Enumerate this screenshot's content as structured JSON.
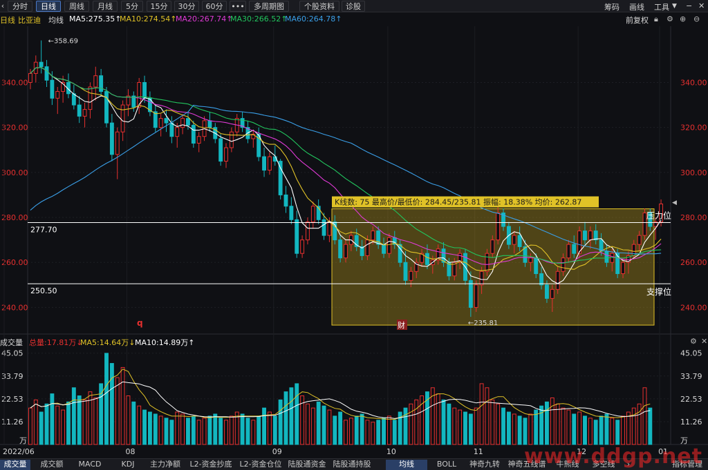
{
  "toolbar": {
    "left_icon": "chevron-left-icon",
    "tabs": [
      {
        "label": "分时",
        "active": false
      },
      {
        "label": "日线",
        "active": true
      },
      {
        "label": "周线",
        "active": false
      },
      {
        "label": "月线",
        "active": false
      },
      {
        "label": "5分",
        "active": false
      },
      {
        "label": "15分",
        "active": false
      },
      {
        "label": "30分",
        "active": false
      },
      {
        "label": "60分",
        "active": false
      },
      {
        "label": "•••",
        "active": false
      },
      {
        "label": "多周期图",
        "active": false
      },
      {
        "label": "个股资料",
        "active": false
      },
      {
        "label": "诊股",
        "active": false
      }
    ],
    "right": {
      "chips": "筹码",
      "draw": "画线",
      "tools": "工具"
    }
  },
  "ma_bar": {
    "period": "日线",
    "stock_name": "比亚迪",
    "avg_line": "均线",
    "ma5": "MA5:275.35↑",
    "ma10": "MA10:274.54↑",
    "ma20": "MA20:267.74↑",
    "ma30": "MA30:266.52↑",
    "ma60": "MA60:264.78↑",
    "adjust": "前复权"
  },
  "annotations": {
    "high_label": "358.69",
    "low_label": "235.81",
    "info_box": "K线数: 75 最高价/最低价: 284.45/235.81 振幅: 18.38% 均价: 262.87",
    "line_upper_value": "277.70",
    "line_lower_value": "250.50",
    "resistance": "压力位",
    "support": "支撑位",
    "marker_q": "q",
    "marker_cai": "财"
  },
  "vol_bar": {
    "title": "成交量",
    "total": "总量:17.81万↓",
    "ma5": "MA5:14.64万↓",
    "ma10": "MA10:14.89万↑"
  },
  "axis": {
    "price_ticks": [
      "340.00",
      "320.00",
      "300.00",
      "280.00",
      "260.00",
      "240.00"
    ],
    "vol_ticks": [
      "45.05",
      "33.79",
      "22.53",
      "11.26",
      "万"
    ],
    "dates": [
      "2022/06",
      "08",
      "09",
      "10",
      "11",
      "12",
      "01"
    ]
  },
  "bottom_tabs": [
    {
      "label": "成交量",
      "active": true
    },
    {
      "label": "成交额",
      "active": false
    },
    {
      "label": "MACD",
      "active": false
    },
    {
      "label": "KDJ",
      "active": false
    },
    {
      "label": "主力净额",
      "active": false
    },
    {
      "label": "L2-资金抄底",
      "active": false
    },
    {
      "label": "L2-资金仓位",
      "active": false
    },
    {
      "label": "陆股通资金",
      "active": false
    },
    {
      "label": "陆股通持股",
      "active": false
    },
    {
      "label": "均线",
      "active": true
    },
    {
      "label": "BOLL",
      "active": false
    },
    {
      "label": "神奇九转",
      "active": false
    },
    {
      "label": "神奇五线谱",
      "active": false
    },
    {
      "label": "牛熊线",
      "active": false
    },
    {
      "label": "多空线",
      "active": false
    },
    {
      "label": "指标管理",
      "active": false
    }
  ],
  "watermark": "www.ddgp.net",
  "colors": {
    "up": "#e8302f",
    "down": "#13b7c0",
    "ma5": "#ffffff",
    "ma10": "#e0c227",
    "ma20": "#e03ad6",
    "ma30": "#22c55e",
    "ma60": "#3a9fe8"
  },
  "chart_data": {
    "type": "candlestick",
    "ylim": [
      230,
      365
    ],
    "high": 358.69,
    "low": 235.81,
    "levels": [
      277.7,
      250.5
    ],
    "box": {
      "count": 75,
      "high": 284.45,
      "low": 235.81,
      "amplitude": "18.38%",
      "avg": 262.87,
      "range": [
        235.81,
        284.45
      ]
    },
    "ohlc": [
      [
        340,
        346,
        337,
        344
      ],
      [
        344,
        352,
        340,
        349
      ],
      [
        349,
        358.69,
        344,
        347
      ],
      [
        347,
        350,
        338,
        341
      ],
      [
        341,
        345,
        330,
        333
      ],
      [
        333,
        338,
        326,
        336
      ],
      [
        336,
        343,
        331,
        340
      ],
      [
        340,
        344,
        333,
        335
      ],
      [
        335,
        339,
        328,
        330
      ],
      [
        330,
        334,
        322,
        325
      ],
      [
        325,
        331,
        320,
        328
      ],
      [
        328,
        340,
        324,
        338
      ],
      [
        338,
        347,
        332,
        343
      ],
      [
        343,
        346,
        334,
        336
      ],
      [
        336,
        338,
        320,
        322
      ],
      [
        322,
        326,
        305,
        308
      ],
      [
        308,
        320,
        297,
        318
      ],
      [
        318,
        332,
        314,
        330
      ],
      [
        330,
        337,
        325,
        334
      ],
      [
        334,
        336,
        327,
        329
      ],
      [
        329,
        342,
        326,
        340
      ],
      [
        340,
        343,
        331,
        333
      ],
      [
        333,
        336,
        325,
        327
      ],
      [
        327,
        330,
        318,
        320
      ],
      [
        320,
        326,
        316,
        324
      ],
      [
        324,
        328,
        318,
        322
      ],
      [
        322,
        325,
        313,
        316
      ],
      [
        316,
        322,
        311,
        320
      ],
      [
        320,
        326,
        317,
        324
      ],
      [
        324,
        327,
        319,
        321
      ],
      [
        321,
        323,
        311,
        313
      ],
      [
        313,
        318,
        309,
        316
      ],
      [
        316,
        325,
        314,
        323
      ],
      [
        323,
        327,
        318,
        320
      ],
      [
        320,
        322,
        313,
        315
      ],
      [
        315,
        317,
        303,
        305
      ],
      [
        305,
        313,
        302,
        311
      ],
      [
        311,
        320,
        309,
        318
      ],
      [
        318,
        326,
        316,
        324
      ],
      [
        324,
        327,
        318,
        320
      ],
      [
        320,
        323,
        313,
        315
      ],
      [
        315,
        319,
        311,
        317
      ],
      [
        317,
        320,
        305,
        307
      ],
      [
        307,
        311,
        298,
        301
      ],
      [
        301,
        309,
        299,
        307
      ],
      [
        307,
        312,
        303,
        305
      ],
      [
        305,
        306,
        288,
        290
      ],
      [
        290,
        294,
        282,
        285
      ],
      [
        285,
        289,
        277,
        279
      ],
      [
        279,
        283,
        262,
        264
      ],
      [
        264,
        272,
        262,
        270
      ],
      [
        270,
        280,
        268,
        278
      ],
      [
        278,
        287,
        275,
        285
      ],
      [
        285,
        288,
        277,
        279
      ],
      [
        279,
        282,
        270,
        272
      ],
      [
        272,
        280,
        269,
        278
      ],
      [
        278,
        281,
        268,
        270
      ],
      [
        270,
        272,
        260,
        262
      ],
      [
        262,
        270,
        260,
        268
      ],
      [
        268,
        274,
        265,
        272
      ],
      [
        272,
        275,
        265,
        267
      ],
      [
        267,
        270,
        261,
        263
      ],
      [
        263,
        272,
        261,
        270
      ],
      [
        270,
        276,
        268,
        274
      ],
      [
        274,
        276,
        266,
        268
      ],
      [
        268,
        271,
        262,
        264
      ],
      [
        264,
        273,
        262,
        271
      ],
      [
        271,
        274,
        266,
        268
      ],
      [
        268,
        270,
        258,
        260
      ],
      [
        260,
        265,
        250,
        252
      ],
      [
        252,
        258,
        249,
        256
      ],
      [
        256,
        262,
        253,
        260
      ],
      [
        260,
        266,
        258,
        264
      ],
      [
        264,
        268,
        257,
        259
      ],
      [
        259,
        263,
        255,
        261
      ],
      [
        261,
        268,
        259,
        266
      ],
      [
        266,
        269,
        258,
        260
      ],
      [
        260,
        262,
        252,
        254
      ],
      [
        254,
        262,
        252,
        260
      ],
      [
        260,
        266,
        257,
        264
      ],
      [
        264,
        266,
        250,
        252
      ],
      [
        252,
        256,
        235.81,
        240
      ],
      [
        240,
        252,
        238,
        250
      ],
      [
        250,
        258,
        246,
        256
      ],
      [
        256,
        266,
        254,
        264
      ],
      [
        264,
        272,
        262,
        270
      ],
      [
        270,
        284.45,
        268,
        282
      ],
      [
        282,
        284,
        274,
        276
      ],
      [
        276,
        278,
        266,
        268
      ],
      [
        268,
        274,
        264,
        272
      ],
      [
        272,
        276,
        265,
        267
      ],
      [
        267,
        270,
        258,
        260
      ],
      [
        260,
        264,
        256,
        262
      ],
      [
        262,
        264,
        253,
        255
      ],
      [
        255,
        258,
        248,
        250
      ],
      [
        250,
        252,
        242,
        244
      ],
      [
        244,
        250,
        238,
        248
      ],
      [
        248,
        258,
        246,
        256
      ],
      [
        256,
        264,
        254,
        262
      ],
      [
        262,
        270,
        260,
        268
      ],
      [
        268,
        272,
        262,
        264
      ],
      [
        264,
        276,
        262,
        274
      ],
      [
        274,
        278,
        268,
        270
      ],
      [
        270,
        276,
        266,
        274
      ],
      [
        274,
        277,
        268,
        270
      ],
      [
        270,
        273,
        263,
        265
      ],
      [
        265,
        268,
        258,
        260
      ],
      [
        260,
        266,
        256,
        264
      ],
      [
        264,
        266,
        253,
        255
      ],
      [
        255,
        262,
        253,
        260
      ],
      [
        260,
        265,
        255,
        263
      ],
      [
        263,
        270,
        262,
        268
      ],
      [
        268,
        274,
        265,
        272
      ],
      [
        272,
        284,
        270,
        282
      ],
      [
        282,
        284,
        274,
        276
      ],
      [
        276,
        280,
        270,
        278
      ],
      [
        278,
        288,
        276,
        286
      ]
    ],
    "volume": [
      18,
      22,
      16,
      20,
      25,
      19,
      17,
      21,
      28,
      24,
      22,
      26,
      23,
      30,
      45,
      40,
      33,
      38,
      24,
      21,
      19,
      17,
      16,
      15,
      14,
      13,
      12,
      16,
      15,
      13,
      14,
      12,
      13,
      14,
      15,
      13,
      12,
      14,
      16,
      15,
      13,
      12,
      14,
      18,
      16,
      14,
      22,
      26,
      28,
      30,
      24,
      20,
      18,
      21,
      19,
      17,
      14,
      16,
      12,
      13,
      14,
      15,
      12,
      11,
      12,
      13,
      14,
      12,
      16,
      18,
      20,
      22,
      24,
      26,
      28,
      25,
      22,
      20,
      18,
      17,
      16,
      15,
      18,
      30,
      28,
      22,
      20,
      18,
      16,
      15,
      14,
      13,
      15,
      17,
      19,
      21,
      23,
      20,
      18,
      17,
      15,
      16,
      14,
      13,
      12,
      14,
      15,
      13,
      12,
      14,
      16,
      18,
      20,
      28,
      18
    ],
    "vol_ylim": [
      0,
      47
    ],
    "x_ticks": [
      "2022/06",
      "08",
      "09",
      "10",
      "11",
      "12",
      "01"
    ],
    "price_ticks": [
      340,
      320,
      300,
      280,
      260,
      240
    ],
    "vol_ticks": [
      45.05,
      33.79,
      22.53,
      11.26
    ]
  }
}
